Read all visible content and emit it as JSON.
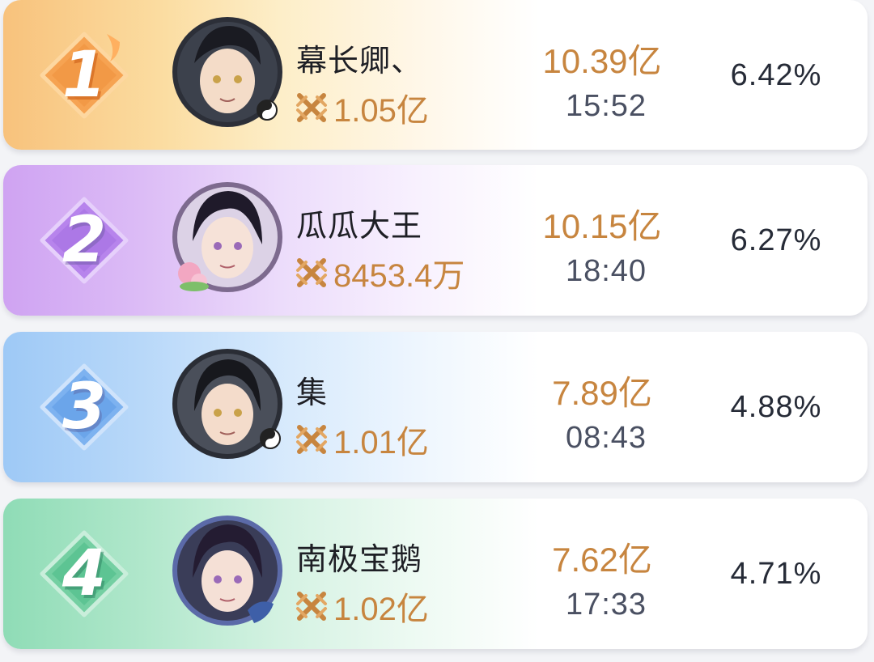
{
  "rows": [
    {
      "rank": "1",
      "name": "幕长卿、",
      "power": "1.05亿",
      "amount": "10.39亿",
      "time": "15:52",
      "percent": "6.42%"
    },
    {
      "rank": "2",
      "name": "瓜瓜大王",
      "power": "8453.4万",
      "amount": "10.15亿",
      "time": "18:40",
      "percent": "6.27%"
    },
    {
      "rank": "3",
      "name": "集",
      "power": "1.01亿",
      "amount": "7.89亿",
      "time": "08:43",
      "percent": "4.88%"
    },
    {
      "rank": "4",
      "name": "南极宝鹅",
      "power": "1.02亿",
      "amount": "7.62亿",
      "time": "17:33",
      "percent": "4.71%"
    }
  ],
  "icons": {
    "power": "crossed-swords-icon",
    "avatar": "character-avatar"
  },
  "colors": {
    "gold": "#c7853f",
    "rank1": "#f8c27c",
    "rank2": "#cfa3f2",
    "rank3": "#9ec9f6",
    "rank4": "#8fdcb6"
  }
}
